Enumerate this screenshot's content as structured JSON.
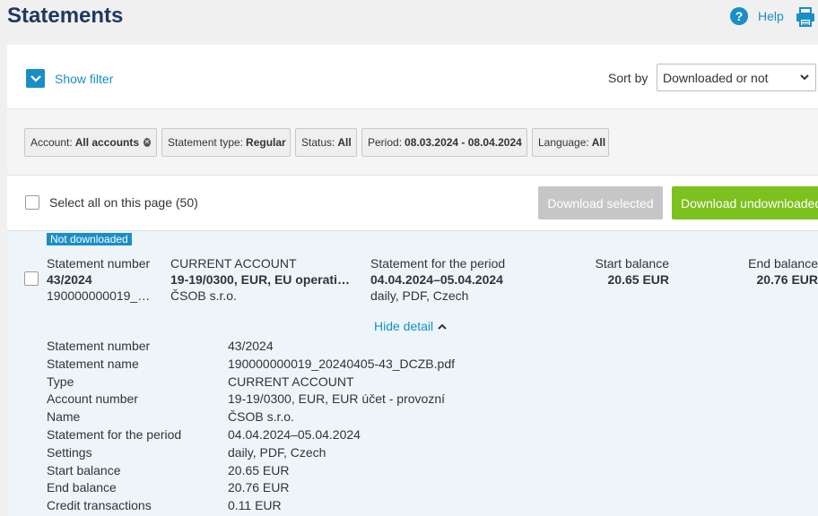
{
  "header": {
    "title": "Statements",
    "help_label": "Help",
    "help_glyph": "?"
  },
  "filter_bar": {
    "show_filter_label": "Show filter",
    "sort_label": "Sort by",
    "sort_value": "Downloaded or not"
  },
  "chips": [
    {
      "key": "Account:",
      "value": "All accounts",
      "removable": true
    },
    {
      "key": "Statement type:",
      "value": "Regular"
    },
    {
      "key": "Status:",
      "value": "All"
    },
    {
      "key": "Period:",
      "value": "08.03.2024 - 08.04.2024"
    },
    {
      "key": "Language:",
      "value": "All"
    }
  ],
  "actions": {
    "select_all_label": "Select all on this page (50)",
    "download_selected_label": "Download selected",
    "download_undownloaded_label": "Download undownloaded"
  },
  "statement": {
    "badge": "Not downloaded",
    "col1": {
      "label": "Statement number",
      "value": "43/2024",
      "sub": "190000000019_…"
    },
    "col2": {
      "label": "CURRENT ACCOUNT",
      "value": "19-19/0300, EUR, EU operati…",
      "sub": "ČSOB s.r.o."
    },
    "col3": {
      "label": "Statement for the period",
      "value": "04.04.2024–05.04.2024",
      "sub": "daily, PDF, Czech"
    },
    "col4": {
      "label": "Start balance",
      "value": "20.65 EUR"
    },
    "col5": {
      "label": "End balance",
      "value": "20.76 EUR"
    },
    "hide_detail_label": "Hide detail",
    "details": [
      {
        "k": "Statement number",
        "v": "43/2024"
      },
      {
        "k": "Statement name",
        "v": "190000000019_20240405-43_DCZB.pdf"
      },
      {
        "k": "Type",
        "v": "CURRENT ACCOUNT"
      },
      {
        "k": "Account number",
        "v": "19-19/0300, EUR, EUR účet - provozní"
      },
      {
        "k": "Name",
        "v": "ČSOB s.r.o."
      },
      {
        "k": "Statement for the period",
        "v": "04.04.2024–05.04.2024"
      },
      {
        "k": "Settings",
        "v": "daily, PDF, Czech"
      },
      {
        "k": "Start balance",
        "v": "20.65 EUR"
      },
      {
        "k": "End balance",
        "v": "20.76 EUR"
      },
      {
        "k": "Credit transactions",
        "v": "0.11 EUR"
      }
    ]
  },
  "colors": {
    "accent": "#1a8ec7",
    "title": "#1f3864",
    "green": "#7cc11e",
    "disabled": "#c6c6c6",
    "row_bg": "#edf5fb"
  }
}
